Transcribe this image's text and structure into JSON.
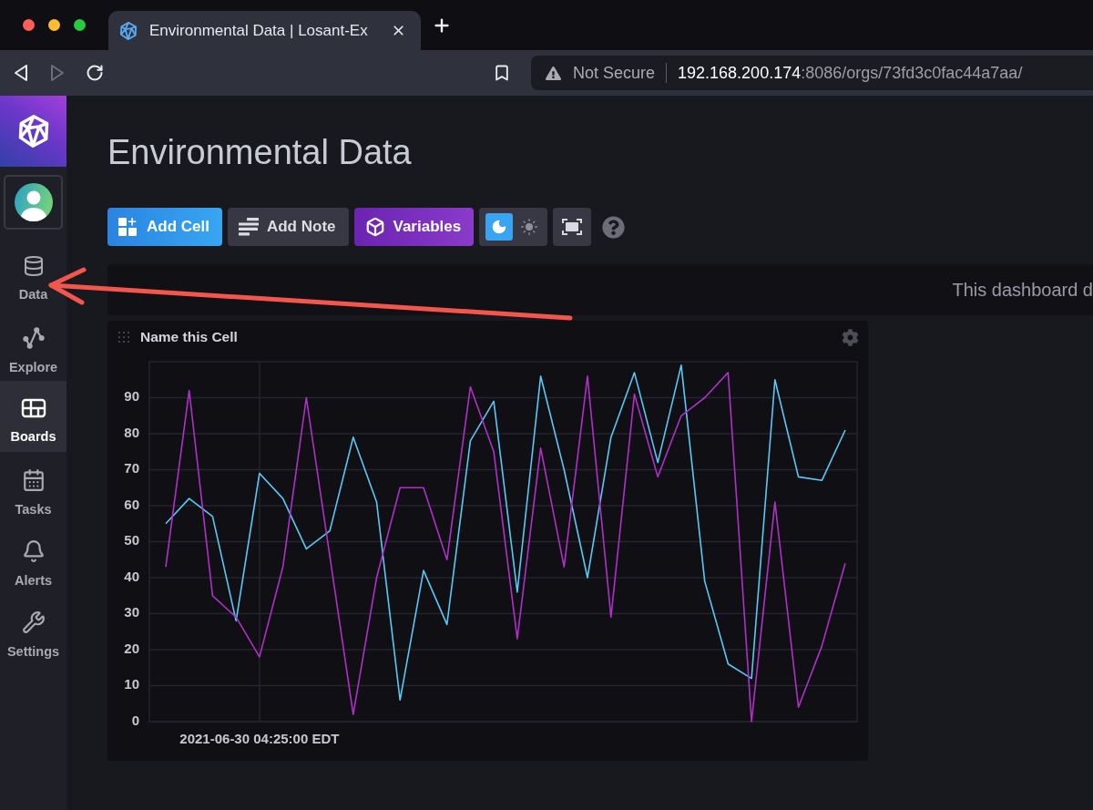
{
  "browser": {
    "traffic_lights": [
      {
        "color": "#fe5f57"
      },
      {
        "color": "#febc2e"
      },
      {
        "color": "#28c840"
      }
    ],
    "tab": {
      "title": "Environmental Data | Losant-Ex"
    },
    "nav_buttons": [
      {
        "kind": "back",
        "disabled": false
      },
      {
        "kind": "forward",
        "disabled": true
      },
      {
        "kind": "reload",
        "disabled": false
      }
    ],
    "address_bar": {
      "security": "Not Secure",
      "host": "192.168.200.174",
      "path": ":8086/orgs/73fd3c0fac44a7aa/"
    }
  },
  "sidebar": {
    "items": [
      {
        "kind": "data",
        "label": "Data",
        "selected": false
      },
      {
        "kind": "explore",
        "label": "Explore",
        "selected": false
      },
      {
        "kind": "boards",
        "label": "Boards",
        "selected": true
      },
      {
        "kind": "tasks",
        "label": "Tasks",
        "selected": false
      },
      {
        "kind": "alerts",
        "label": "Alerts",
        "selected": false
      },
      {
        "kind": "settings",
        "label": "Settings",
        "selected": false
      }
    ]
  },
  "page": {
    "title": "Environmental Data"
  },
  "toolbar": {
    "buttons": [
      {
        "kind": "add-cell",
        "label": "Add Cell"
      },
      {
        "kind": "add-note",
        "label": "Add Note"
      },
      {
        "kind": "variables",
        "label": "Variables"
      }
    ],
    "theme": [
      {
        "kind": "dark",
        "selected": true
      },
      {
        "kind": "light",
        "selected": false
      }
    ]
  },
  "banner": {
    "text": "This dashboard d"
  },
  "cell": {
    "title": "Name this Cell",
    "chart_data": {
      "type": "line",
      "grid": true,
      "ylim": [
        0,
        100
      ],
      "yticks": [
        0,
        10,
        20,
        30,
        40,
        50,
        60,
        70,
        80,
        90
      ],
      "annotations": [
        "2021-06-30 04:25:00 EDT"
      ],
      "series": [
        {
          "color": "#5bc8f5",
          "values": [
            55,
            62,
            57,
            28,
            69,
            62,
            48,
            53,
            79,
            61,
            6,
            42,
            27,
            78,
            89,
            36,
            96,
            70,
            40,
            79,
            97,
            72,
            99,
            39,
            16,
            12,
            95,
            68,
            67,
            81
          ]
        },
        {
          "color": "#b030c8",
          "values": [
            43,
            92,
            35,
            29,
            18,
            43,
            90,
            46,
            2,
            40,
            65,
            65,
            45,
            93,
            75,
            23,
            76,
            43,
            96,
            29,
            91,
            68,
            85,
            90,
            97,
            0,
            61,
            4,
            21,
            44
          ]
        }
      ]
    }
  },
  "annotation": {
    "kind": "arrow",
    "color": "#f2564d"
  }
}
